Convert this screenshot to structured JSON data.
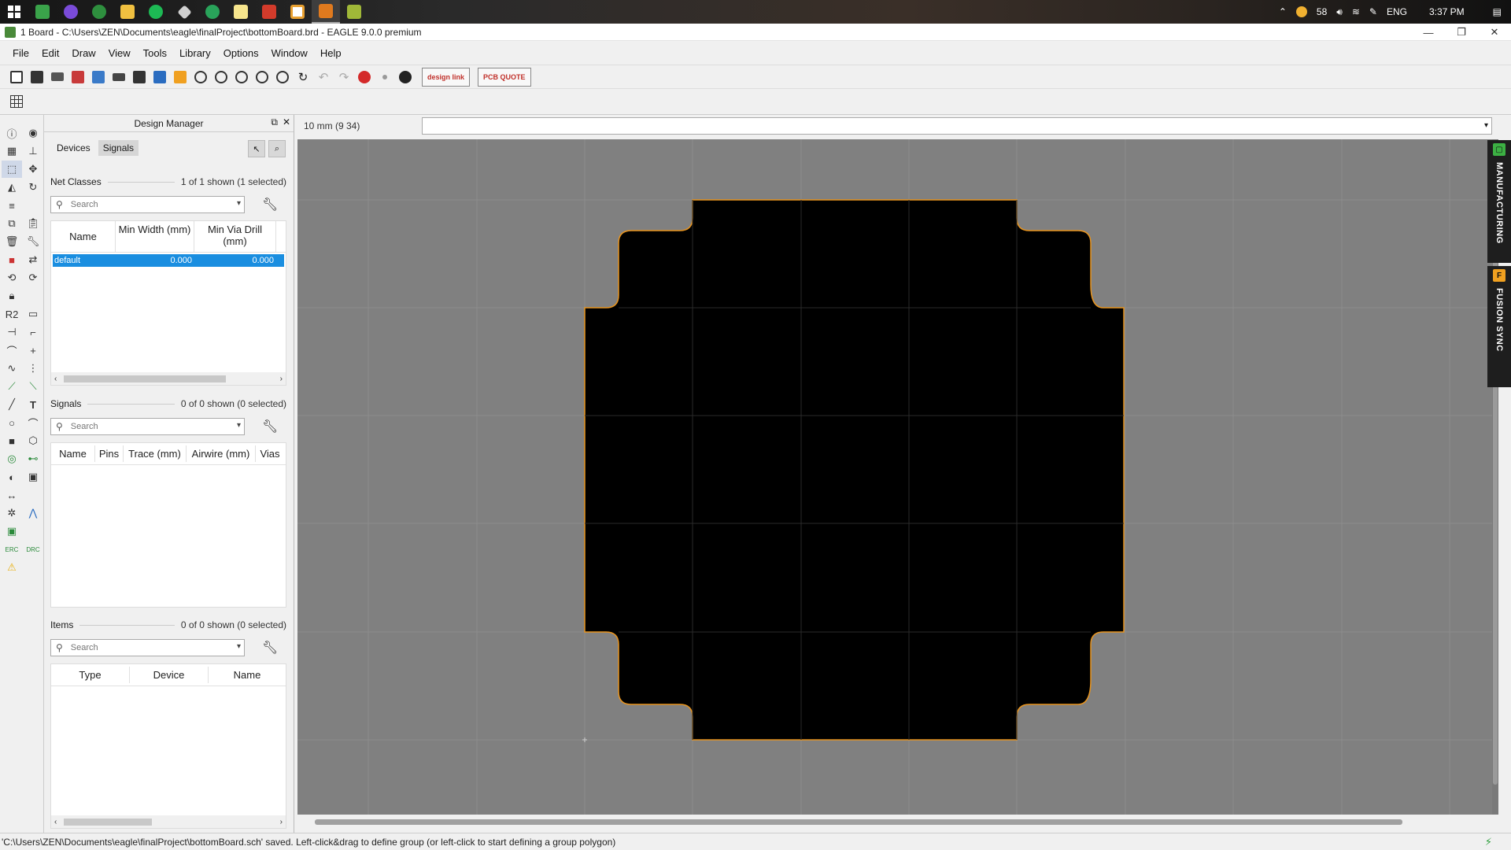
{
  "window": {
    "title": "1 Board - C:\\Users\\ZEN\\Documents\\eagle\\finalProject\\bottomBoard.brd - EAGLE 9.0.0 premium",
    "controls": {
      "minimize": "—",
      "restore": "❐",
      "close": "✕"
    }
  },
  "taskbar": {
    "tray": {
      "weather": "58",
      "language": "ENG",
      "time": "3:37 PM"
    },
    "apps": [
      {
        "name": "start",
        "color": "#ffffff"
      },
      {
        "name": "app-green",
        "color": "#3aa34a"
      },
      {
        "name": "firefox",
        "color": "#7a4bd8"
      },
      {
        "name": "chrome",
        "color": "#2e8f3e"
      },
      {
        "name": "file-explorer",
        "color": "#f0c040"
      },
      {
        "name": "spotify",
        "color": "#1db954"
      },
      {
        "name": "git",
        "color": "#d0d0d0"
      },
      {
        "name": "messenger",
        "color": "#29a35a"
      },
      {
        "name": "sticky",
        "color": "#f6e58d"
      },
      {
        "name": "acrobat",
        "color": "#d33b2b"
      },
      {
        "name": "fusion",
        "color": "#e8a030"
      },
      {
        "name": "eagle",
        "color": "#e07a1e"
      },
      {
        "name": "calendar",
        "color": "#a0b838"
      }
    ]
  },
  "menu": [
    "File",
    "Edit",
    "Draw",
    "View",
    "Tools",
    "Library",
    "Options",
    "Window",
    "Help"
  ],
  "toolbar": {
    "design_link_label": "design link",
    "pcb_quote_label": "PCB QUOTE"
  },
  "design_manager": {
    "title": "Design Manager",
    "tabs": [
      "Devices",
      "Signals"
    ],
    "net_classes": {
      "label": "Net Classes",
      "count": "1 of 1 shown (1 selected)",
      "search_placeholder": "Search",
      "columns": [
        "Name",
        "Min Width (mm)",
        "Min Via Drill (mm)"
      ],
      "rows": [
        {
          "name": "default",
          "min_width": "0.000",
          "min_via_drill": "0.000"
        }
      ]
    },
    "signals": {
      "label": "Signals",
      "count": "0 of 0 shown (0 selected)",
      "search_placeholder": "Search",
      "columns": [
        "Name",
        "Pins",
        "Trace (mm)",
        "Airwire (mm)",
        "Vias"
      ]
    },
    "items": {
      "label": "Items",
      "count": "0 of 0 shown (0 selected)",
      "search_placeholder": "Search",
      "columns": [
        "Type",
        "Device",
        "Name"
      ]
    }
  },
  "canvas": {
    "coordinate": "10 mm (9 34)",
    "command_value": "",
    "side_tabs": [
      {
        "label": "MANUFACTURING",
        "icon_color": "#3cb043",
        "icon": "manufacturing-icon"
      },
      {
        "label": "FUSION SYNC",
        "icon_color": "#f0a020",
        "icon": "fusion-icon"
      }
    ],
    "board_fill": "#000000",
    "board_outline": "#e8941e",
    "background": "#808080"
  },
  "status": {
    "message": "'C:\\Users\\ZEN\\Documents\\eagle\\finalProject\\bottomBoard.sch' saved. Left-click&drag to define group (or left-click to start defining a group polygon)"
  }
}
